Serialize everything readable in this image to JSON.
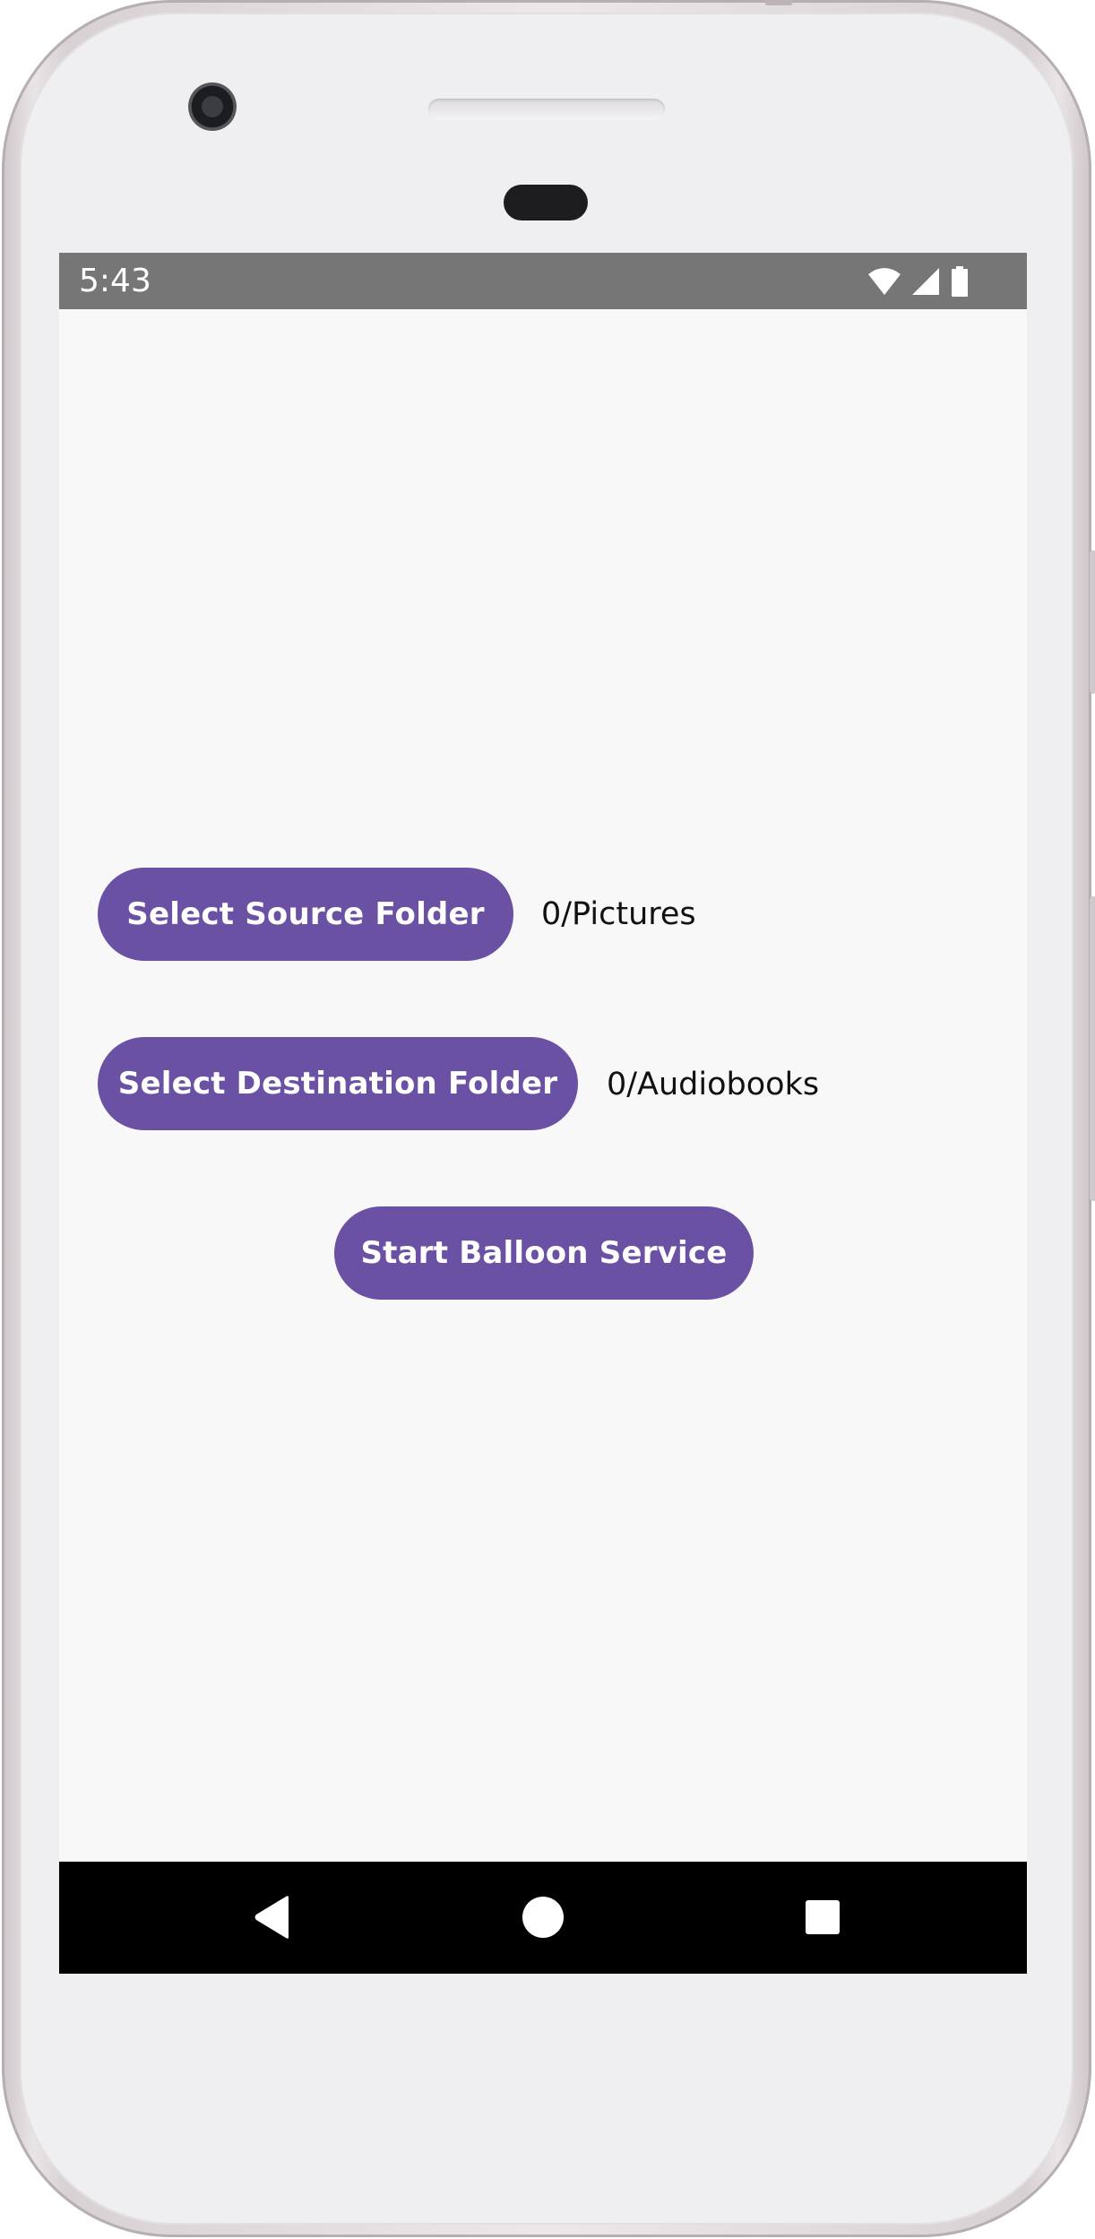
{
  "status_bar": {
    "time": "5:43",
    "icons": [
      "wifi-icon",
      "cellular-signal-icon",
      "battery-icon"
    ]
  },
  "main": {
    "source_button_label": "Select Source Folder",
    "source_folder_value": "0/Pictures",
    "destination_button_label": "Select Destination Folder",
    "destination_folder_value": "0/Audiobooks",
    "start_button_label": "Start Balloon Service"
  },
  "nav_bar": {
    "buttons": [
      "back-icon",
      "home-icon",
      "recents-icon"
    ]
  },
  "colors": {
    "button_background": "#6a51a4",
    "button_text": "#ffffff",
    "screen_background": "#f8f8f9",
    "status_bar": "#767676",
    "nav_bar": "#000000"
  }
}
